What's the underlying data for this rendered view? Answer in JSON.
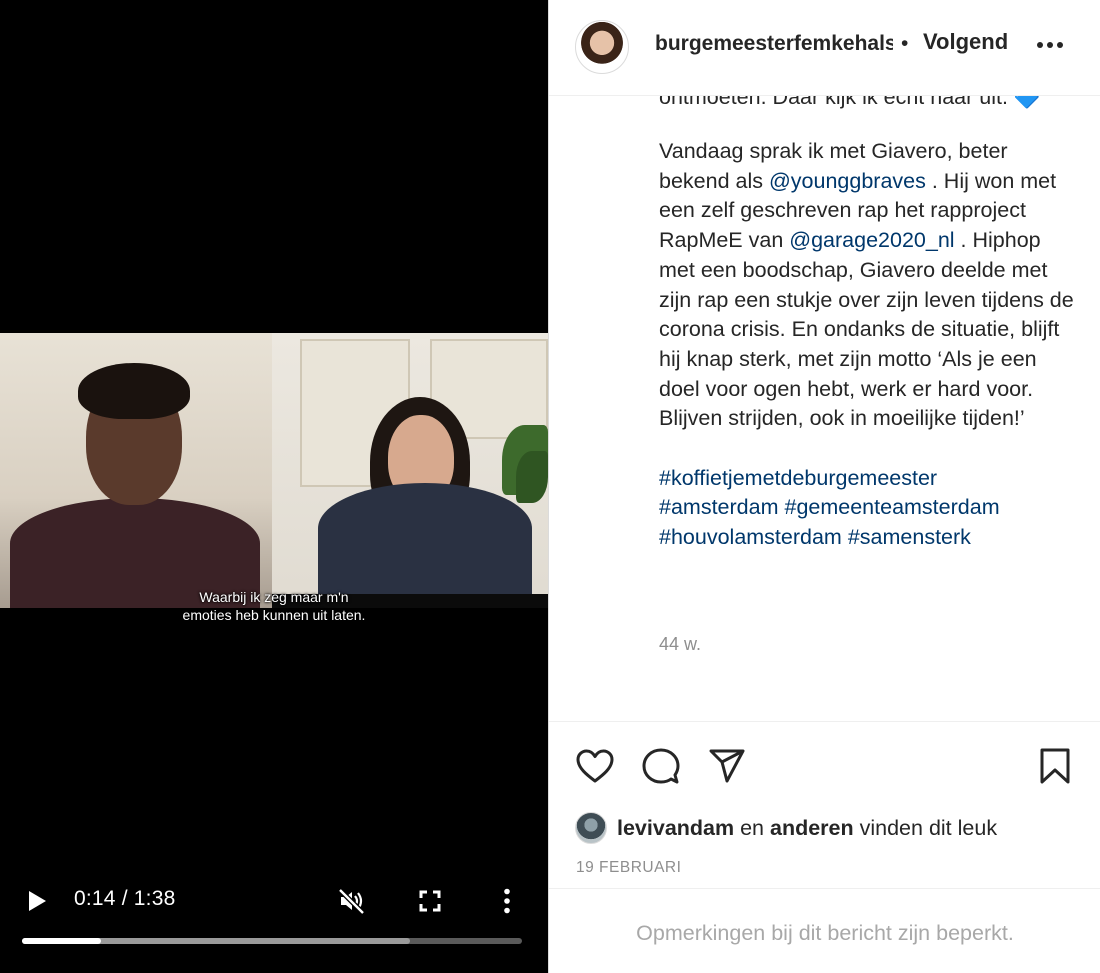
{
  "video": {
    "subtitle_lines": [
      "Waarbij ik zeg maar m'n",
      "emoties heb kunnen uit laten."
    ],
    "time_display": "0:14 / 1:38",
    "current_time": "0:14",
    "duration": "1:38",
    "progress_played": 0.158,
    "progress_buffered": 0.776,
    "controls": {
      "play_icon": "play-icon",
      "mute_icon": "volume-muted-icon",
      "fullscreen_icon": "fullscreen-icon",
      "more_icon": "more-vertical-icon"
    }
  },
  "post": {
    "username": "burgemeesterfemkehalsema",
    "separator": "•",
    "follow_label": "Volgend",
    "options_icon": "more-horizontal-icon",
    "caption_cutoff": "ontmoeten. Daar kijk ik echt naar uit. 🔷",
    "caption": {
      "p1": [
        {
          "type": "text",
          "text": "Vandaag sprak ik met Giavero, beter bekend als "
        },
        {
          "type": "mention",
          "text": "@younggbraves"
        },
        {
          "type": "text",
          "text": " . Hij won met een zelf geschreven rap het rapproject RapMeE van "
        },
        {
          "type": "mention",
          "text": "@garage2020_nl"
        },
        {
          "type": "text",
          "text": " . Hiphop met een boodschap, Giavero deelde met zijn rap een stukje over zijn leven tijdens de corona crisis. En ondanks de situatie, blijft hij knap sterk, met zijn motto ‘Als je een doel voor ogen hebt, werk er hard voor. Blijven strijden, ook in moeilijke tijden!’"
        }
      ],
      "hashtags": [
        "#koffietjemetdeburgemeester",
        "#amsterdam",
        "#gemeenteamsterdam",
        "#houvolamsterdam",
        "#samensterk"
      ]
    },
    "age": "44 w.",
    "actions": {
      "like_icon": "heart-icon",
      "comment_icon": "comment-icon",
      "share_icon": "send-icon",
      "save_icon": "bookmark-icon"
    },
    "likes": {
      "user": "levivandam",
      "mid": " en ",
      "others": "anderen",
      "suffix": " vinden dit leuk"
    },
    "date": "19 FEBRUARI",
    "comments_notice": "Opmerkingen bij dit bericht zijn beperkt."
  },
  "colors": {
    "link": "#00376b",
    "muted": "#8e8e8e",
    "text": "#262626",
    "video_bg": "#000000"
  }
}
